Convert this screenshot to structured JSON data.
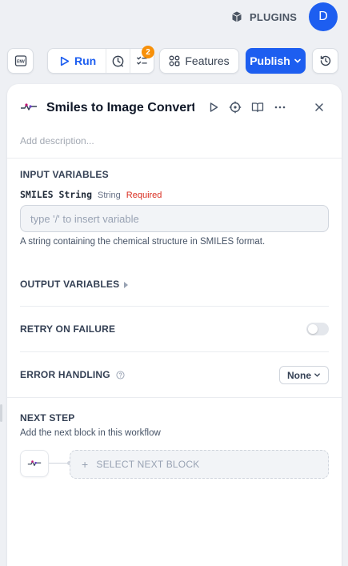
{
  "header": {
    "plugins_label": "PLUGINS",
    "avatar_initial": "D"
  },
  "toolbar": {
    "env_label": "ENV",
    "run_label": "Run",
    "checklist_badge": "2",
    "features_label": "Features",
    "publish_label": "Publish"
  },
  "node": {
    "title": "Smiles to Image Converter",
    "description_placeholder": "Add description..."
  },
  "input_variables": {
    "section_title": "INPUT VARIABLES",
    "items": [
      {
        "name": "SMILES String",
        "type": "String",
        "required": "Required",
        "placeholder": "type '/' to insert variable",
        "help": "A string containing the chemical structure in SMILES format."
      }
    ]
  },
  "output_variables": {
    "section_title": "OUTPUT VARIABLES"
  },
  "retry": {
    "section_title": "RETRY ON FAILURE",
    "enabled": false
  },
  "error_handling": {
    "section_title": "ERROR HANDLING",
    "value": "None"
  },
  "next_step": {
    "section_title": "NEXT STEP",
    "description": "Add the next block in this workflow",
    "select_label": "SELECT NEXT BLOCK"
  },
  "colors": {
    "accent": "#1d5ef0",
    "badge": "#f79009",
    "required": "#d92d20"
  }
}
